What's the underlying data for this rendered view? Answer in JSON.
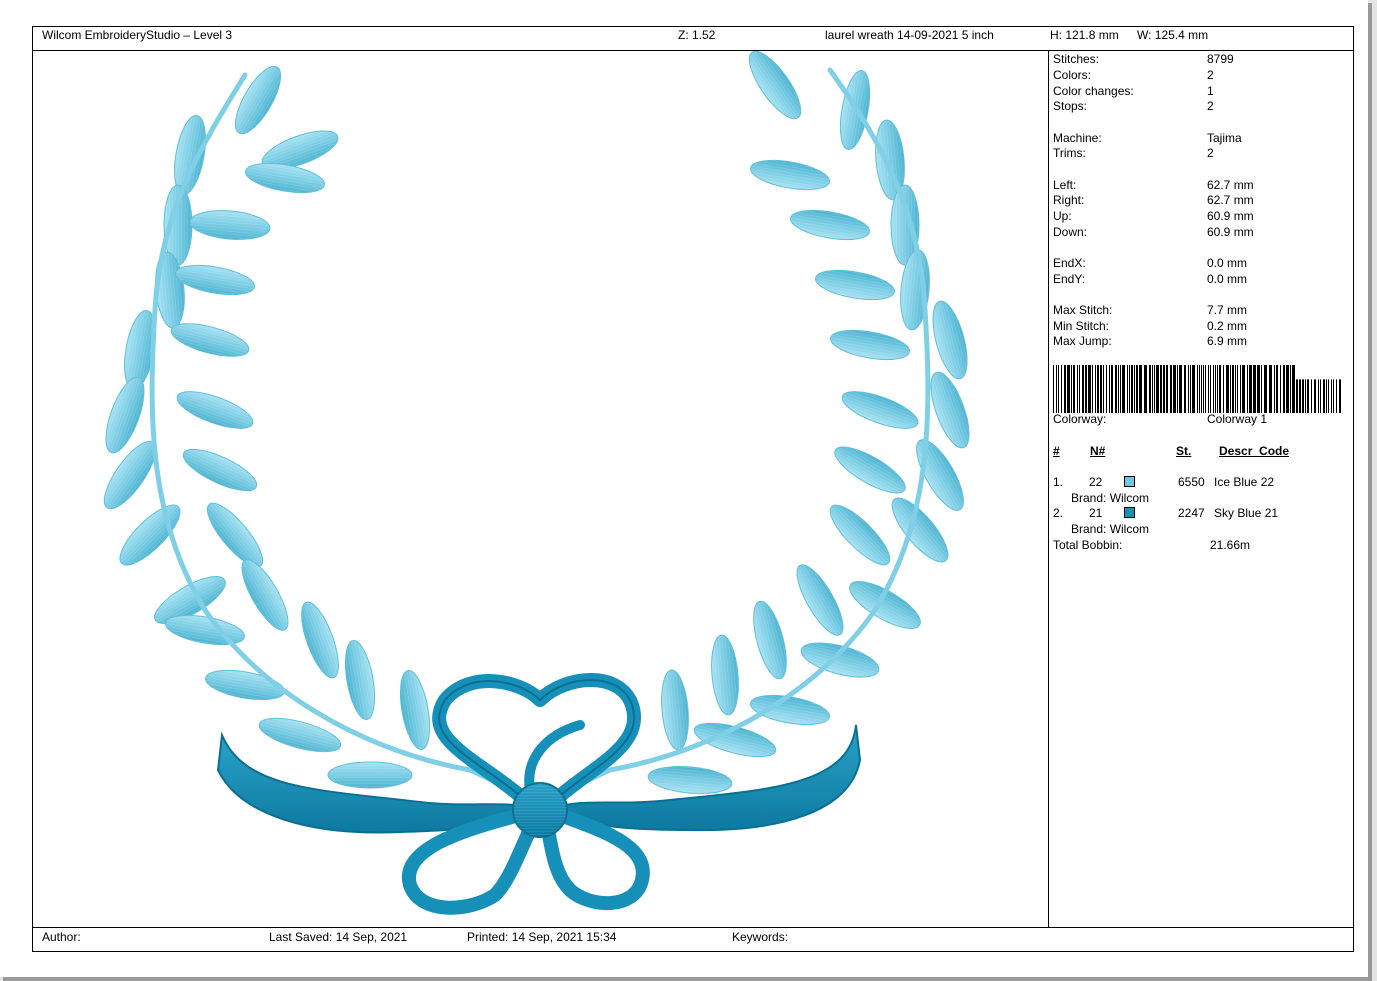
{
  "header": {
    "app_title": "Wilcom EmbroideryStudio – Level 3",
    "zoom": "Z: 1.52",
    "design_name": "laurel wreath 14-09-2021 5 inch",
    "height": "H: 121.8 mm",
    "width": "W: 125.4 mm"
  },
  "stats": {
    "stitches_label": "Stitches:",
    "stitches_value": "8799",
    "colors_label": "Colors:",
    "colors_value": "2",
    "color_changes_label": "Color changes:",
    "color_changes_value": "1",
    "stops_label": "Stops:",
    "stops_value": "2",
    "machine_label": "Machine:",
    "machine_value": "Tajima",
    "trims_label": "Trims:",
    "trims_value": "2",
    "left_label": "Left:",
    "left_value": "62.7 mm",
    "right_label": "Right:",
    "right_value": "62.7 mm",
    "up_label": "Up:",
    "up_value": "60.9 mm",
    "down_label": "Down:",
    "down_value": "60.9 mm",
    "endx_label": "EndX:",
    "endx_value": "0.0 mm",
    "endy_label": "EndY:",
    "endy_value": "0.0 mm",
    "max_stitch_label": "Max Stitch:",
    "max_stitch_value": "7.7 mm",
    "min_stitch_label": "Min Stitch:",
    "min_stitch_value": "0.2 mm",
    "max_jump_label": "Max Jump:",
    "max_jump_value": "6.9 mm",
    "colorway_label": "Colorway:",
    "colorway_value": "Colorway 1"
  },
  "color_table": {
    "headers": [
      "#",
      "N#",
      "St.",
      "Descr_Code"
    ],
    "rows": [
      {
        "index": "1.",
        "number": "22",
        "color": "#6fc6e4",
        "stitches": "6550",
        "description": "Ice Blue 22",
        "brand": "Brand: Wilcom"
      },
      {
        "index": "2.",
        "number": "21",
        "color": "#1690b8",
        "stitches": "2247",
        "description": "Sky Blue 21",
        "brand": "Brand: Wilcom"
      }
    ],
    "total_bobbin_label": "Total Bobbin:",
    "total_bobbin_value": "21.66m"
  },
  "footer": {
    "author": "Author:",
    "last_saved": "Last Saved: 14 Sep, 2021",
    "printed": "Printed: 14 Sep, 2021 15:34",
    "keywords": "Keywords:"
  },
  "colors": {
    "leaf_light": "#8fd6ea",
    "leaf_dark": "#4ab3cf",
    "ribbon": "#1690b8",
    "ribbon_dark": "#0b6f93"
  }
}
